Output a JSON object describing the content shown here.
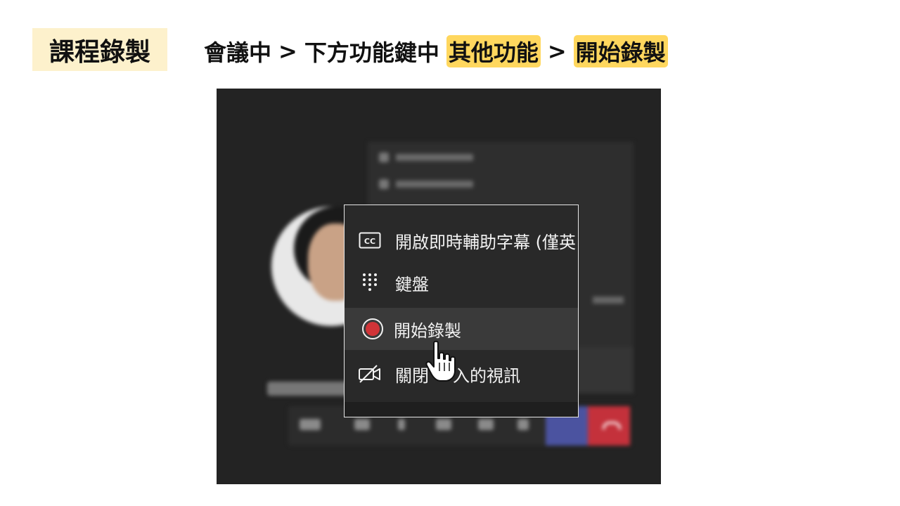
{
  "slide": {
    "title": "課程錄製",
    "breadcrumb": {
      "part1": "會議中",
      "sep1": ">",
      "part2": "下方功能鍵中",
      "part3": "其他功能",
      "sep2": ">",
      "part4": "開始錄製"
    }
  },
  "menu": {
    "items": [
      {
        "label": "開啟即時輔助字幕 (僅英",
        "icon": "closed-captions-icon"
      },
      {
        "label": "鍵盤",
        "icon": "keypad-icon"
      },
      {
        "label": "開始錄製",
        "icon": "record-icon"
      },
      {
        "label": "關閉",
        "icon": "video-off-icon"
      }
    ],
    "item4_suffix": "入的視訊"
  },
  "colors": {
    "title_bg": "#fdf1cc",
    "highlight": "#ffd75e",
    "record_red": "#d13438",
    "hangup_red": "#c4313b",
    "share_blue": "#4b53a0"
  }
}
